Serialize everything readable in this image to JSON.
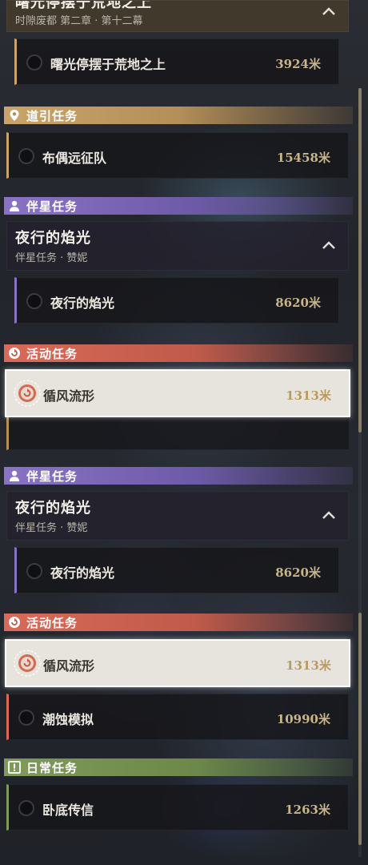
{
  "top_group": {
    "title": "曙光停摆于荒地之上",
    "subtitle": "时隙废都 第二章 · 第十二幕",
    "quest": {
      "name": "曙光停摆于荒地之上",
      "distance": "3924米"
    }
  },
  "guide_section": {
    "label": "道引任务",
    "quest": {
      "name": "布偶远征队",
      "distance": "15458米"
    }
  },
  "partner_section_1": {
    "label": "伴星任务",
    "group_title": "夜行的焰光",
    "group_subtitle": "伴星任务 · 赞妮",
    "quest": {
      "name": "夜行的焰光",
      "distance": "8620米"
    }
  },
  "event_section_1": {
    "label": "活动任务",
    "quest": {
      "name": "循风流形",
      "distance": "1313米"
    }
  },
  "partner_section_2": {
    "label": "伴星任务",
    "group_title": "夜行的焰光",
    "group_subtitle": "伴星任务 · 赞妮",
    "quest": {
      "name": "夜行的焰光",
      "distance": "8620米"
    }
  },
  "event_section_2": {
    "label": "活动任务",
    "quests": [
      {
        "name": "循风流形",
        "distance": "1313米"
      },
      {
        "name": "潮蚀模拟",
        "distance": "10990米"
      }
    ]
  },
  "daily_section": {
    "label": "日常任务",
    "quest": {
      "name": "卧底传信",
      "distance": "1263米"
    }
  },
  "colors": {
    "guide": "#c9a56b",
    "partner": "#8a73c6",
    "event": "#d96a58",
    "daily": "#7f9a5a",
    "distance": "#c8b58a"
  },
  "icons": {
    "guide": "map-pin-icon",
    "partner": "person-icon",
    "event": "event-cycle-icon",
    "daily": "exclamation-box-icon",
    "collapse": "chevron-up-icon",
    "track": "tracking-target-icon"
  }
}
